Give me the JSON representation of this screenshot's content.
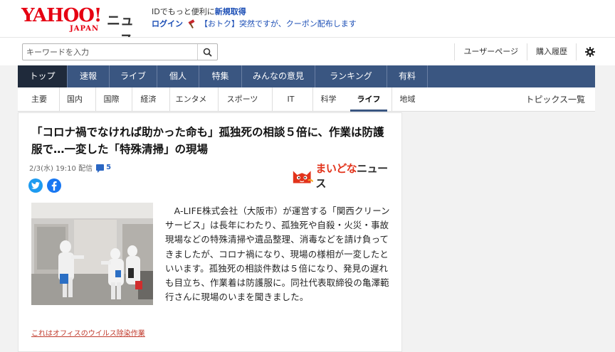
{
  "header": {
    "logo_yahoo": "YAHOO!",
    "logo_japan": "JAPAN",
    "logo_news": "ニュース",
    "promo_line1_prefix": "IDでもっと便利に",
    "promo_line1_link": "新規取得",
    "login": "ログイン",
    "promo_line2": "【おトク】突然ですが、クーポン配布します"
  },
  "search": {
    "placeholder": "キーワードを入力",
    "button_icon": "search-icon"
  },
  "utils": {
    "user_page": "ユーザーページ",
    "history": "購入履歴",
    "settings_icon": "gear-icon"
  },
  "nav": {
    "items": [
      {
        "label": "トップ"
      },
      {
        "label": "速報"
      },
      {
        "label": "ライブ"
      },
      {
        "label": "個人"
      },
      {
        "label": "特集"
      },
      {
        "label": "みんなの意見"
      },
      {
        "label": "ランキング"
      },
      {
        "label": "有料"
      }
    ],
    "active": "トップ"
  },
  "subnav": {
    "items": [
      {
        "label": "主要"
      },
      {
        "label": "国内"
      },
      {
        "label": "国際"
      },
      {
        "label": "経済"
      },
      {
        "label": "エンタメ"
      },
      {
        "label": "スポーツ"
      },
      {
        "label": "IT"
      },
      {
        "label": "科学"
      },
      {
        "label": "ライフ"
      },
      {
        "label": "地域"
      }
    ],
    "active": "ライフ",
    "topics": "トピックス一覧"
  },
  "article": {
    "title": "「コロナ禍でなければ助かった命も」孤独死の相談５倍に、作業は防護服で…一変した「特殊清掃」の現場",
    "date": "2/3(水) 19:10 配信",
    "comment_count": "5",
    "publisher_part1": "まいどな",
    "publisher_part2": "ニュース",
    "caption": "これはオフィスのウイルス除染作業",
    "body": "　A-LIFE株式会社（大阪市）が運営する「関西クリーンサービス」は長年にわたり、孤独死や自殺・火災・事故現場などの特殊清掃や遺品整理、消毒などを請け負ってきましたが、コロナ禍になり、現場の様相が一変したといいます。孤独死の相談件数は５倍になり、発見の遅れも目立ち、作業着は防護服に。同社代表取締役の亀澤範行さんに現場のいまを聞きました。"
  },
  "colors": {
    "brand_red": "#e60012",
    "nav_bg": "#3a5681",
    "nav_active": "#1f2a3b",
    "link_blue": "#1a4db5",
    "caption_red": "#c0392b"
  }
}
